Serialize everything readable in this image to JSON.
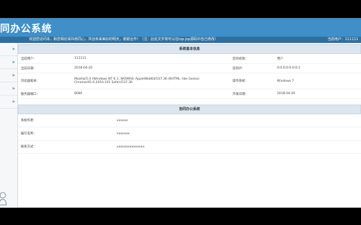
{
  "header": {
    "title": "同办公系统"
  },
  "notice": "欢迎您访问本，和您相处得并肩同心，共创未来美好的明天，谢谢合作！（注：此处文字将可以在top.jsp源码中自己修改）",
  "user": "当前用户：111111",
  "sysinfo": {
    "heading": "系统基本信息",
    "rows": [
      {
        "l1": "当前用户：",
        "v1": "111111",
        "l2": "您的权限：",
        "v2": "用户"
      },
      {
        "l1": "当前日期：",
        "v1": "2018-04-20",
        "l2": "您的IP：",
        "v2": "0:0:0:0:0:0:0:1"
      },
      {
        "l1": "浏览器版本：",
        "v1": "Mozilla/5.0 (Windows NT 6.1; WOW64) AppleWebKit/537.36 (KHTML, like Gecko) Chrome/45.0.2454.101 Safari/537.36",
        "l2": "操作系统：",
        "v2": "Windows 7"
      },
      {
        "l1": "服务器端口：",
        "v1": "8080",
        "l2": "开发日期：",
        "v2": "2018-04-20"
      }
    ]
  },
  "oa": {
    "heading": "协同办公系统",
    "rows": [
      {
        "label": "系统作者：",
        "value": "xxxxxx"
      },
      {
        "label": "编写名称：",
        "value": "xxxxxxx"
      },
      {
        "label": "联系方式：",
        "value": "xxxxxxxxxxxxxxx"
      }
    ]
  }
}
